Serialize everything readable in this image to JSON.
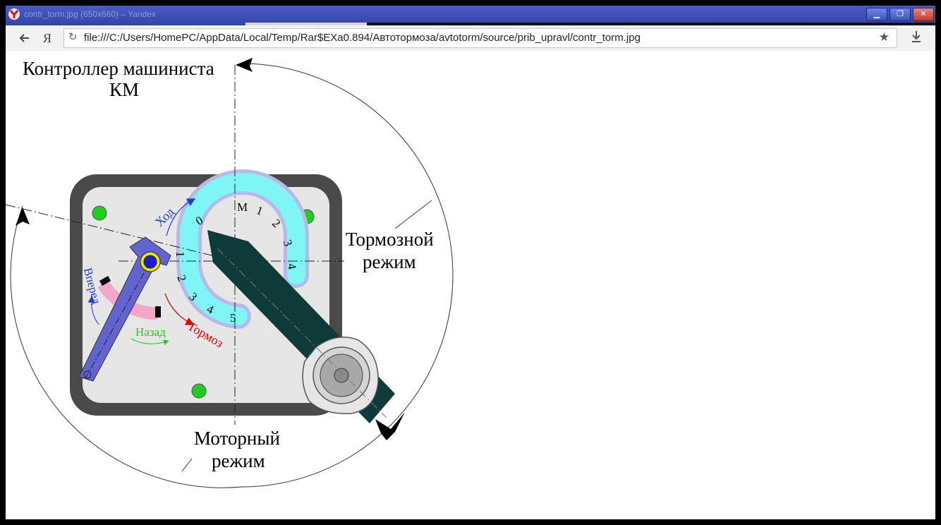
{
  "window": {
    "tab_title": "contr_torm.jpg (650x660) – Yandex",
    "buttons": {
      "minimize": "▁",
      "maximize": "❐",
      "close": "✕"
    }
  },
  "toolbar": {
    "back_icon": "arrow-left-icon",
    "yandex_label": "Я",
    "reload_icon": "reload-icon",
    "url": "file:///C:/Users/HomePC/AppData/Local/Temp/Rar$EXa0.894/Автотормоза/avtotorm/source/prib_upravl/contr_torm.jpg",
    "star_icon": "star-icon",
    "download_icon": "download-icon"
  },
  "diagram": {
    "title_line1": "Контроллер машиниста",
    "title_line2": "КМ",
    "brake_line1": "Тормозной",
    "brake_line2": "режим",
    "motor_line1": "Моторный",
    "motor_line2": "режим",
    "khod": "Ход",
    "vpered": "Вперед",
    "nazad": "Назад",
    "tormoz": "Тормоз",
    "scale": [
      "0",
      "М",
      "1",
      "2",
      "3",
      "4",
      "1",
      "2",
      "3",
      "4",
      "5"
    ],
    "colors": {
      "housing": "#4a4a4a",
      "panel": "#e6e6e6",
      "scale_fill": "#7ff5f5",
      "scale_border": "#b9b9e8",
      "reverser": "#6464d0",
      "reverser_arc": "#f4a6c8",
      "main_handle": "#0e3a3a",
      "dot": "#1ecd1e",
      "khod_arrow": "#1f3fd0",
      "tormoz_arrow": "#e00000",
      "nazad_text": "#22cc22"
    }
  }
}
